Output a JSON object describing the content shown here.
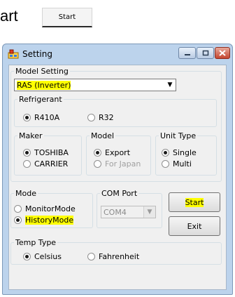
{
  "instruction": {
    "text": "art",
    "button_label": "Start"
  },
  "window": {
    "title": "Setting",
    "controls": {
      "minimize": "minimize",
      "maximize": "maximize",
      "close": "close"
    },
    "model_setting": {
      "legend": "Model Setting",
      "selected": "RAS (Inverter)",
      "refrigerant": {
        "legend": "Refrigerant",
        "options": [
          "R410A",
          "R32"
        ],
        "selected": "R410A"
      },
      "maker": {
        "legend": "Maker",
        "options": [
          "TOSHIBA",
          "CARRIER"
        ],
        "selected": "TOSHIBA"
      },
      "model": {
        "legend": "Model",
        "options": [
          "Export",
          "For Japan"
        ],
        "selected": "Export"
      },
      "unit_type": {
        "legend": "Unit Type",
        "options": [
          "Single",
          "Multi"
        ],
        "selected": "Single"
      }
    },
    "mode": {
      "legend": "Mode",
      "options": [
        "MonitorMode",
        "HistoryMode"
      ],
      "selected": "HistoryMode"
    },
    "com_port": {
      "legend": "COM Port",
      "value": "COM4"
    },
    "buttons": {
      "start": "Start",
      "exit": "Exit"
    },
    "temp_type": {
      "legend": "Temp Type",
      "options": [
        "Celsius",
        "Fahrenheit"
      ],
      "selected": "Celsius"
    }
  },
  "colors": {
    "highlight": "#ffff00",
    "window_frame": "#bcd3ec",
    "client_bg": "#f0f0f0"
  }
}
